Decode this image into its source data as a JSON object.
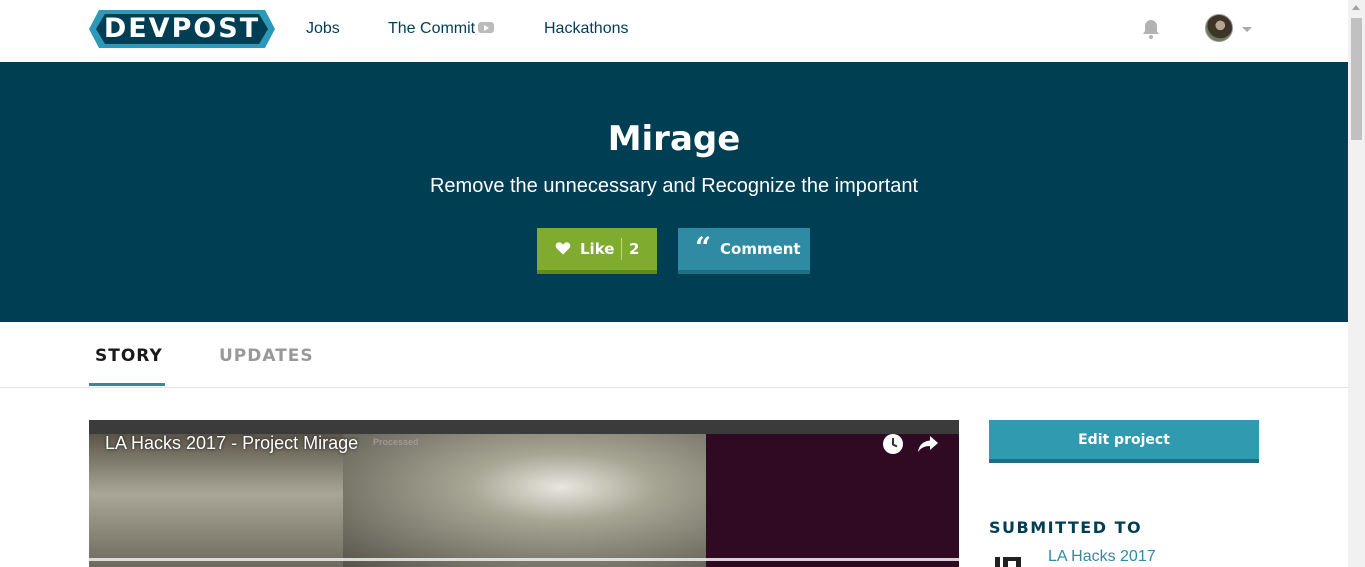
{
  "nav": {
    "logo": "DEVPOST",
    "links": [
      {
        "label": "Jobs"
      },
      {
        "label": "The Commit",
        "icon": "youtube-icon"
      },
      {
        "label": "Hackathons"
      }
    ],
    "notifications_icon": "bell-icon",
    "user_avatar_icon": "avatar",
    "menu_caret_icon": "chevron-down-icon"
  },
  "hero": {
    "title": "Mirage",
    "tagline": "Remove the unnecessary and Recognize the important",
    "like_label": "Like",
    "like_count": "2",
    "comment_label": "Comment"
  },
  "tabs": [
    {
      "label": "STORY",
      "active": true
    },
    {
      "label": "UPDATES",
      "active": false
    }
  ],
  "video": {
    "title": "LA Hacks 2017 - Project Mirage",
    "overlay_status": "Processed",
    "watch_later_icon": "clock-icon",
    "share_icon": "share-icon"
  },
  "sidebar": {
    "edit_label": "Edit project",
    "submitted_heading": "SUBMITTED TO",
    "hackathon_name": "LA Hacks 2017"
  },
  "colors": {
    "hero_bg": "#003e54",
    "like_green": "#7fab2f",
    "accent_teal": "#2f8aa3"
  }
}
